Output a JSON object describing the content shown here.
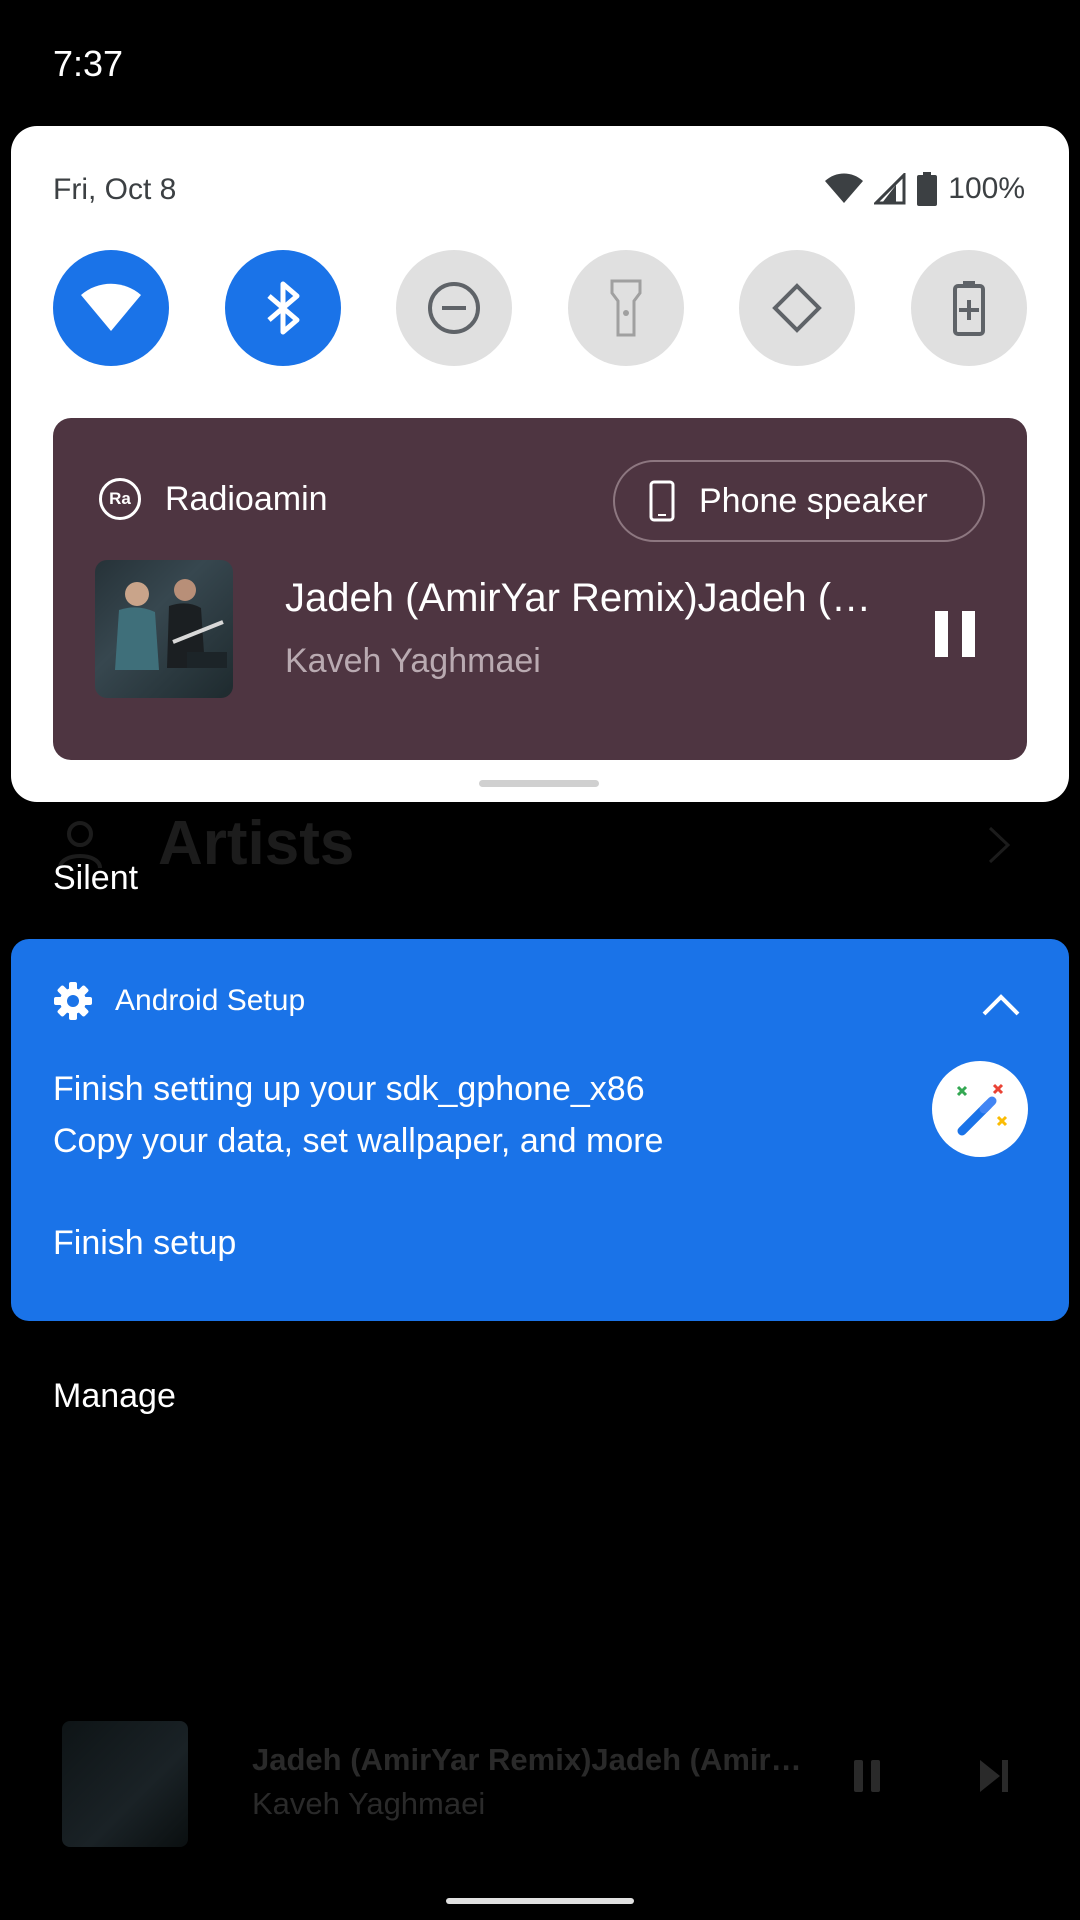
{
  "status_bar": {
    "time": "7:37"
  },
  "quick_settings": {
    "date": "Fri, Oct 8",
    "battery": "100%",
    "tiles": [
      {
        "name": "wifi",
        "state": "on"
      },
      {
        "name": "bluetooth",
        "state": "on"
      },
      {
        "name": "do-not-disturb",
        "state": "off"
      },
      {
        "name": "flashlight",
        "state": "off"
      },
      {
        "name": "auto-rotate",
        "state": "off"
      },
      {
        "name": "battery-saver",
        "state": "off"
      }
    ]
  },
  "media": {
    "app_name": "Radioamin",
    "app_icon_text": "Ra",
    "output": "Phone speaker",
    "title": "Jadeh (AmirYar Remix)Jadeh (…",
    "artist": "Kaveh Yaghmaei",
    "card_color": "#4e3541"
  },
  "background": {
    "artists_label": "Artists",
    "mini_player": {
      "title": "Jadeh (AmirYar Remix)Jadeh (Amir…",
      "artist": "Kaveh Yaghmaei"
    }
  },
  "section_label": "Silent",
  "notification": {
    "app_name": "Android Setup",
    "title": "Finish setting up your sdk_gphone_x86",
    "text": "Copy your data, set wallpaper, and more",
    "action": "Finish setup",
    "color": "#1a73e8"
  },
  "manage_label": "Manage"
}
